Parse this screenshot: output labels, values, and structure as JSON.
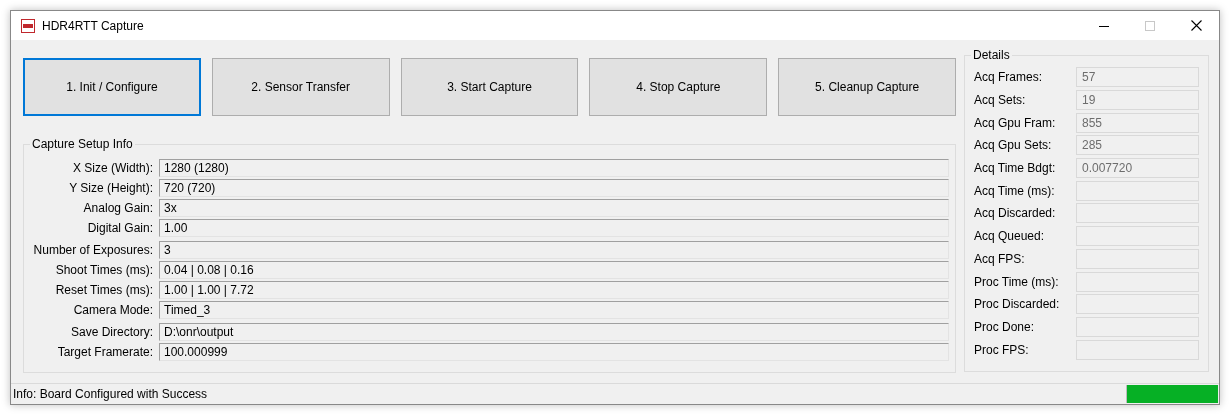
{
  "window": {
    "title": "HDR4RTT Capture",
    "maximize_disabled": true
  },
  "buttons": [
    {
      "label": "1. Init / Configure",
      "focused": true
    },
    {
      "label": "2. Sensor Transfer",
      "focused": false
    },
    {
      "label": "3. Start Capture",
      "focused": false
    },
    {
      "label": "4. Stop Capture",
      "focused": false
    },
    {
      "label": "5. Cleanup Capture",
      "focused": false
    }
  ],
  "setup": {
    "title": "Capture Setup Info",
    "sections": [
      {
        "rows": [
          {
            "label": "X Size (Width):",
            "value": "1280 (1280)"
          },
          {
            "label": "Y Size (Height):",
            "value": "720 (720)"
          },
          {
            "label": "Analog Gain:",
            "value": "3x"
          },
          {
            "label": "Digital Gain:",
            "value": "1.00"
          }
        ]
      },
      {
        "rows": [
          {
            "label": "Number of Exposures:",
            "value": "3"
          },
          {
            "label": "Shoot Times (ms):",
            "value": "0.04 | 0.08 | 0.16"
          },
          {
            "label": "Reset Times (ms):",
            "value": "1.00 | 1.00 | 7.72"
          },
          {
            "label": "Camera Mode:",
            "value": "Timed_3"
          }
        ]
      },
      {
        "rows": [
          {
            "label": "Save Directory:",
            "value": "D:\\onr\\output"
          },
          {
            "label": "Target Framerate:",
            "value": "100.000999"
          }
        ]
      }
    ]
  },
  "details": {
    "title": "Details",
    "rows": [
      {
        "label": "Acq Frames:",
        "value": "57",
        "disabled": true
      },
      {
        "label": "Acq Sets:",
        "value": "19",
        "disabled": true
      },
      {
        "label": "Acq Gpu Fram:",
        "value": "855",
        "disabled": true
      },
      {
        "label": "Acq Gpu Sets:",
        "value": "285",
        "disabled": true
      },
      {
        "label": "Acq Time Bdgt:",
        "value": "0.007720",
        "disabled": true
      },
      {
        "label": "Acq Time (ms):",
        "disabled": true
      },
      {
        "label": "Acq Discarded:",
        "disabled": true
      },
      {
        "label": "Acq Queued:",
        "disabled": true
      },
      {
        "label": "Acq FPS:",
        "disabled": true
      },
      {
        "label": "Proc Time (ms):",
        "disabled": true
      },
      {
        "label": "Proc Discarded:",
        "disabled": true
      },
      {
        "label": "Proc Done:",
        "disabled": true
      },
      {
        "label": "Proc FPS:",
        "disabled": true
      }
    ]
  },
  "status_bar": {
    "text": "Info: Board Configured with Success",
    "progress": {
      "level": 1
    }
  }
}
